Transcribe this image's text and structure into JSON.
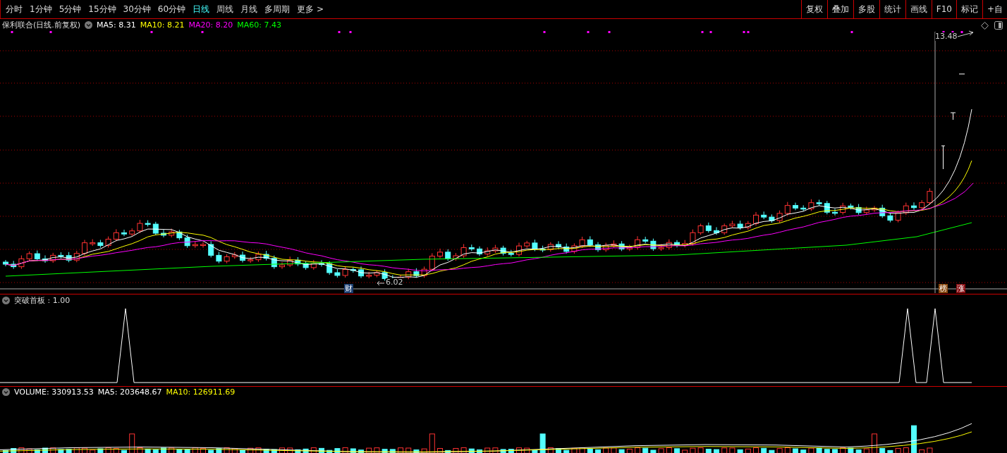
{
  "toolbar": {
    "periods": [
      {
        "label": "分时",
        "selected": false
      },
      {
        "label": "1分钟",
        "selected": false
      },
      {
        "label": "5分钟",
        "selected": false
      },
      {
        "label": "15分钟",
        "selected": false
      },
      {
        "label": "30分钟",
        "selected": false
      },
      {
        "label": "60分钟",
        "selected": false
      },
      {
        "label": "日线",
        "selected": true
      },
      {
        "label": "周线",
        "selected": false
      },
      {
        "label": "月线",
        "selected": false
      },
      {
        "label": "多周期",
        "selected": false
      },
      {
        "label": "更多 >",
        "selected": false
      }
    ],
    "tools": [
      "复权",
      "叠加",
      "多股",
      "统计",
      "画线",
      "F10",
      "标记",
      "+自"
    ]
  },
  "main_pane": {
    "title": "保利联合(日线.前复权)",
    "indicators": [
      {
        "label": "MA5: 8.31",
        "color": "#ffffff"
      },
      {
        "label": "MA10: 8.21",
        "color": "#ffff00"
      },
      {
        "label": "MA20: 8.20",
        "color": "#ff00ff"
      },
      {
        "label": "MA60: 7.43",
        "color": "#00ff00"
      }
    ],
    "high_label": "13.48",
    "low_label": "6.02",
    "badges": [
      {
        "text": "财",
        "color": "#1c3f73"
      },
      {
        "text": "榜",
        "color": "#8a4a10"
      },
      {
        "text": "涨",
        "color": "#8a0e12"
      }
    ]
  },
  "indicator_pane": {
    "title": "突破首板 : 1.00"
  },
  "volume_pane": {
    "indicators": [
      {
        "label": "VOLUME: 330913.53",
        "color": "#ffffff"
      },
      {
        "label": "MA5: 203648.67",
        "color": "#ffffff"
      },
      {
        "label": "MA10: 126911.69",
        "color": "#ffff00"
      }
    ]
  }
}
